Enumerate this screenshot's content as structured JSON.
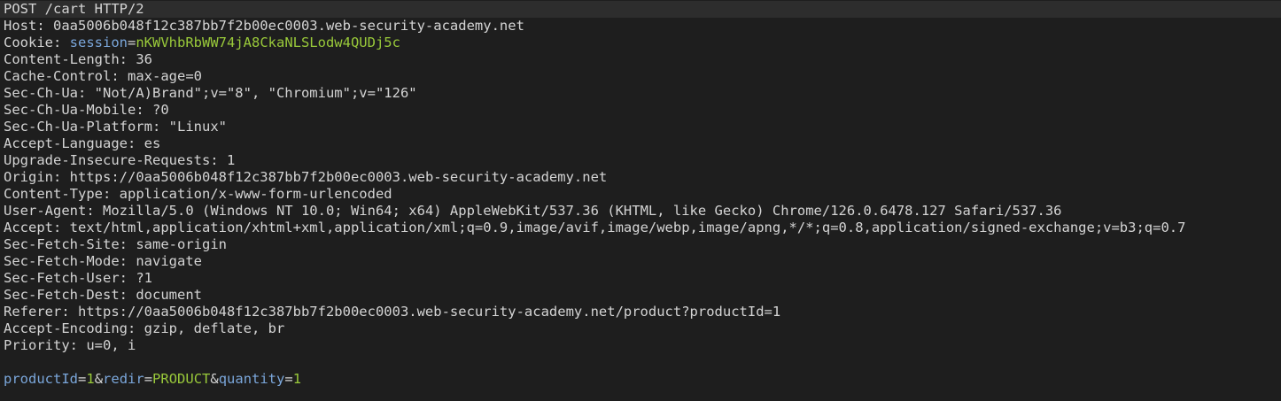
{
  "request": {
    "request_line": "POST /cart HTTP/2",
    "headers": [
      {
        "name": "Host",
        "value": "0aa5006b048f12c387bb7f2b00ec0003.web-security-academy.net"
      },
      {
        "name": "Content-Length",
        "value": "36"
      },
      {
        "name": "Cache-Control",
        "value": "max-age=0"
      },
      {
        "name": "Sec-Ch-Ua",
        "value": "\"Not/A)Brand\";v=\"8\", \"Chromium\";v=\"126\""
      },
      {
        "name": "Sec-Ch-Ua-Mobile",
        "value": "?0"
      },
      {
        "name": "Sec-Ch-Ua-Platform",
        "value": "\"Linux\""
      },
      {
        "name": "Accept-Language",
        "value": "es"
      },
      {
        "name": "Upgrade-Insecure-Requests",
        "value": "1"
      },
      {
        "name": "Origin",
        "value": "https://0aa5006b048f12c387bb7f2b00ec0003.web-security-academy.net"
      },
      {
        "name": "Content-Type",
        "value": "application/x-www-form-urlencoded"
      },
      {
        "name": "User-Agent",
        "value": "Mozilla/5.0 (Windows NT 10.0; Win64; x64) AppleWebKit/537.36 (KHTML, like Gecko) Chrome/126.0.6478.127 Safari/537.36"
      },
      {
        "name": "Accept",
        "value": "text/html,application/xhtml+xml,application/xml;q=0.9,image/avif,image/webp,image/apng,*/*;q=0.8,application/signed-exchange;v=b3;q=0.7"
      },
      {
        "name": "Sec-Fetch-Site",
        "value": "same-origin"
      },
      {
        "name": "Sec-Fetch-Mode",
        "value": "navigate"
      },
      {
        "name": "Sec-Fetch-User",
        "value": "?1"
      },
      {
        "name": "Sec-Fetch-Dest",
        "value": "document"
      },
      {
        "name": "Referer",
        "value": "https://0aa5006b048f12c387bb7f2b00ec0003.web-security-academy.net/product?productId=1"
      },
      {
        "name": "Accept-Encoding",
        "value": "gzip, deflate, br"
      },
      {
        "name": "Priority",
        "value": "u=0, i"
      }
    ],
    "cookie": {
      "header_name": "Cookie",
      "param_name": "session",
      "param_value": "nKWVhbRbWW74jA8CkaNLSLodw4QUDj5c"
    },
    "body_params": [
      {
        "name": "productId",
        "value": "1"
      },
      {
        "name": "redir",
        "value": "PRODUCT"
      },
      {
        "name": "quantity",
        "value": "1"
      }
    ]
  },
  "colors": {
    "background": "#1e1e1e",
    "highlight_line": "#2d2d2d",
    "text": "#d4d4d4",
    "param_name": "#7aa6da",
    "param_value": "#99c93a"
  }
}
